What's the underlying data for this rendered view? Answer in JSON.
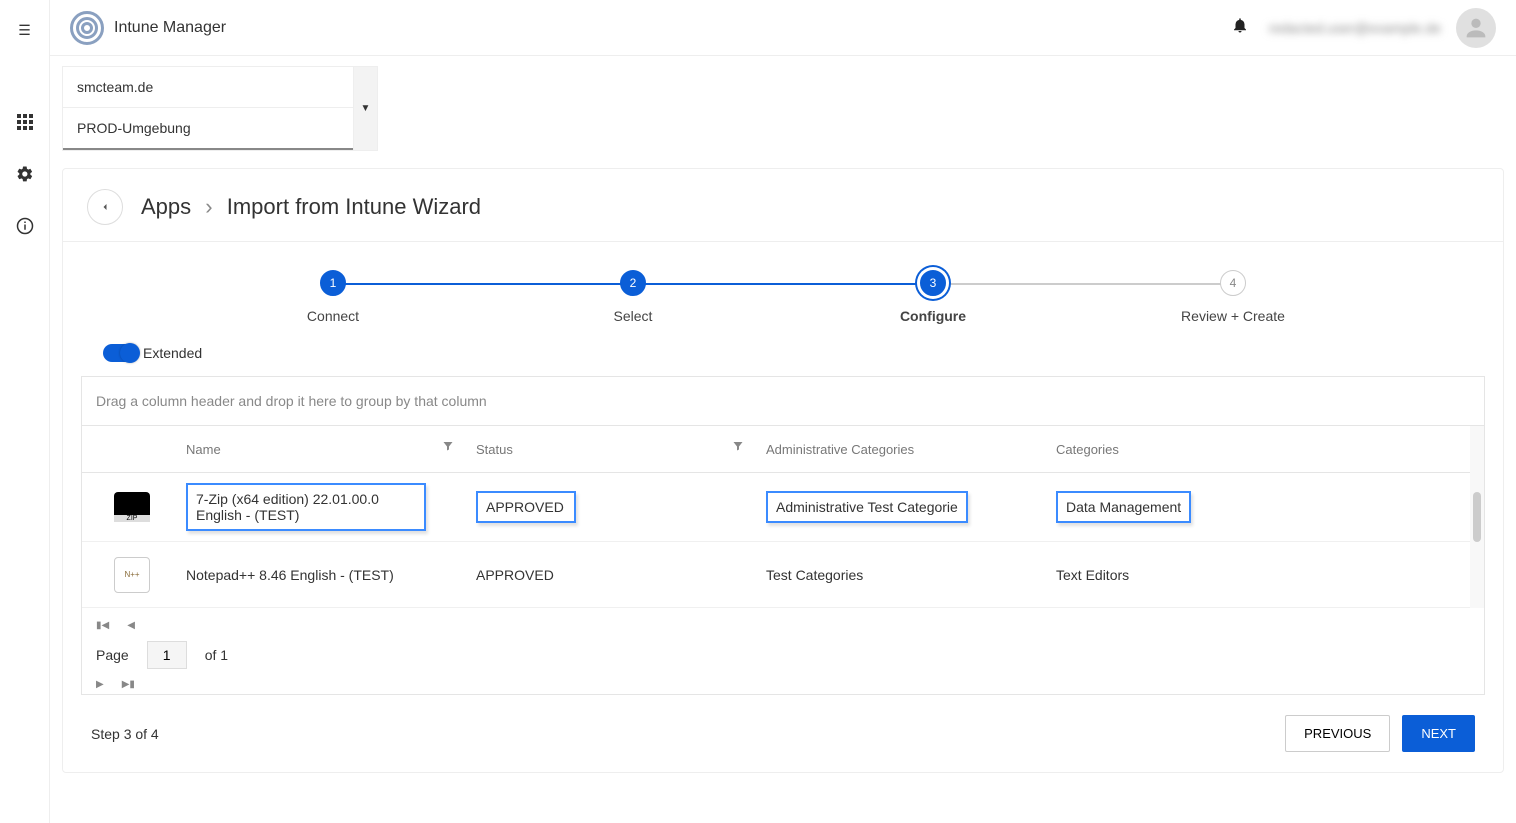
{
  "app": {
    "title": "Intune Manager",
    "user_email": "redacted.user@example.de"
  },
  "selectors": {
    "tenant": "smcteam.de",
    "environment": "PROD-Umgebung"
  },
  "breadcrumb": {
    "root": "Apps",
    "page": "Import from Intune Wizard"
  },
  "stepper": {
    "steps": [
      {
        "num": "1",
        "label": "Connect"
      },
      {
        "num": "2",
        "label": "Select"
      },
      {
        "num": "3",
        "label": "Configure"
      },
      {
        "num": "4",
        "label": "Review + Create"
      }
    ],
    "current_index": 2
  },
  "toggle": {
    "label": "Extended",
    "on": true
  },
  "grid": {
    "group_by_hint": "Drag a column header and drop it here to group by that column",
    "columns": {
      "name": "Name",
      "status": "Status",
      "admin_categories": "Administrative Categories",
      "categories": "Categories"
    },
    "rows": [
      {
        "icon": "7zip",
        "name": "7-Zip (x64 edition) 22.01.00.0 English - (TEST)",
        "status": "APPROVED",
        "admin_categories": "Administrative Test Categorie",
        "categories": "Data Management",
        "editing": true
      },
      {
        "icon": "npp",
        "name": "Notepad++ 8.46 English - (TEST)",
        "status": "APPROVED",
        "admin_categories": "Test Categories",
        "categories": "Text Editors",
        "editing": false
      }
    ],
    "pager": {
      "page_label": "Page",
      "page_value": "1",
      "of_label": "of",
      "total": "1"
    }
  },
  "footer": {
    "step_text": "Step 3 of 4",
    "previous": "PREVIOUS",
    "next": "NEXT"
  }
}
